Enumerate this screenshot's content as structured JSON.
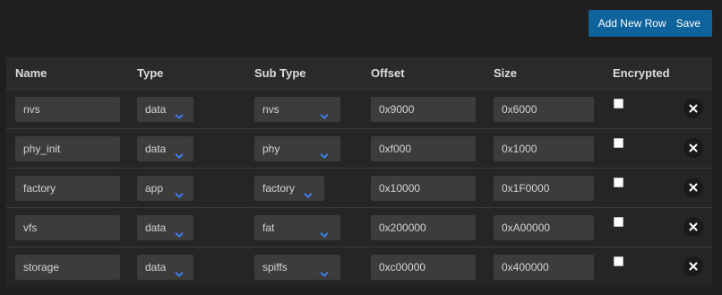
{
  "toolbar": {
    "add_label": "Add New Row",
    "save_label": "Save",
    "accent": "#0e639c"
  },
  "table": {
    "headers": {
      "name": "Name",
      "type": "Type",
      "subtype": "Sub Type",
      "offset": "Offset",
      "size": "Size",
      "encrypted": "Encrypted"
    },
    "rows": [
      {
        "name": "nvs",
        "type": "data",
        "subtype": "nvs",
        "offset": "0x9000",
        "size": "0x6000",
        "encrypted": false
      },
      {
        "name": "phy_init",
        "type": "data",
        "subtype": "phy",
        "offset": "0xf000",
        "size": "0x1000",
        "encrypted": false
      },
      {
        "name": "factory",
        "type": "app",
        "subtype": "factory",
        "offset": "0x10000",
        "size": "0x1F0000",
        "encrypted": false
      },
      {
        "name": "vfs",
        "type": "data",
        "subtype": "fat",
        "offset": "0x200000",
        "size": "0xA00000",
        "encrypted": false
      },
      {
        "name": "storage",
        "type": "data",
        "subtype": "spiffs",
        "offset": "0xc00000",
        "size": "0x400000",
        "encrypted": false
      }
    ],
    "chevron_color": "#3b82f6",
    "delete_icon": "close-icon"
  }
}
